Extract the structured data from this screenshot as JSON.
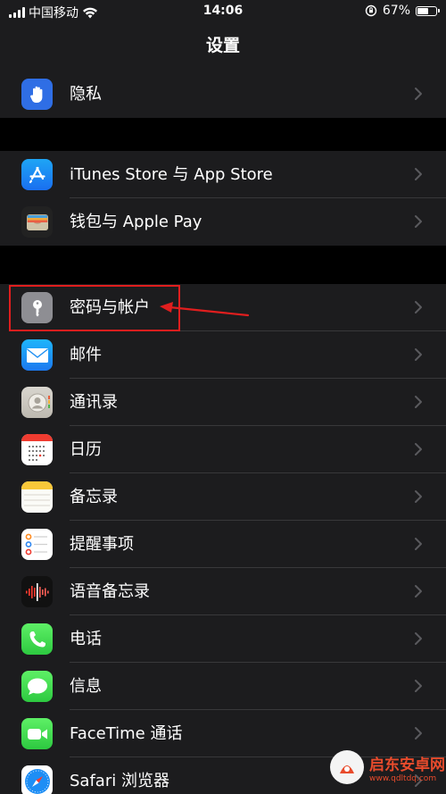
{
  "status_bar": {
    "carrier": "中国移动",
    "time": "14:06",
    "battery": "67%",
    "battery_level": 0.67
  },
  "nav": {
    "title": "设置"
  },
  "groups": [
    {
      "items": [
        {
          "label": "隐私",
          "icon": "hand-icon"
        }
      ]
    },
    {
      "items": [
        {
          "label": "iTunes Store 与 App Store",
          "icon": "app-store-icon"
        },
        {
          "label": "钱包与 Apple Pay",
          "icon": "wallet-icon"
        }
      ]
    },
    {
      "items": [
        {
          "label": "密码与帐户",
          "icon": "key-icon"
        },
        {
          "label": "邮件",
          "icon": "mail-icon"
        },
        {
          "label": "通讯录",
          "icon": "contacts-icon"
        },
        {
          "label": "日历",
          "icon": "calendar-icon"
        },
        {
          "label": "备忘录",
          "icon": "notes-icon"
        },
        {
          "label": "提醒事项",
          "icon": "reminders-icon"
        },
        {
          "label": "语音备忘录",
          "icon": "voice-memos-icon"
        },
        {
          "label": "电话",
          "icon": "phone-icon"
        },
        {
          "label": "信息",
          "icon": "messages-icon"
        },
        {
          "label": "FaceTime 通话",
          "icon": "facetime-icon"
        },
        {
          "label": "Safari 浏览器",
          "icon": "safari-icon"
        }
      ]
    }
  ],
  "colors": {
    "background": "#000000",
    "cell": "#1c1c1e",
    "separator": "#38383a",
    "chevron": "#5a5a5e",
    "annotation": "#e01e1e"
  },
  "watermark": {
    "name": "启东安卓网",
    "url": "www.qdltdq.com"
  }
}
